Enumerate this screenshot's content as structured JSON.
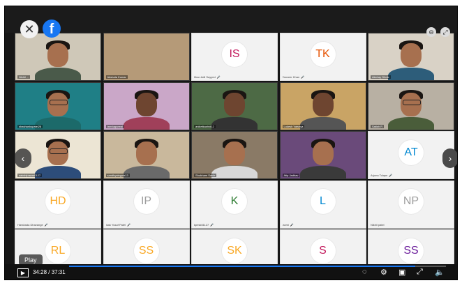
{
  "player": {
    "close_glyph": "✕",
    "facebook_glyph": "f",
    "play_tooltip": "Play",
    "time": "34:28 / 37:31",
    "progress_fraction": 0.919,
    "accent": "#1877f2"
  },
  "tiles": [
    {
      "kind": "video",
      "name": "Nikhil ...",
      "theme": "wall",
      "skin": "light",
      "shirt": "#4a5a4a"
    },
    {
      "kind": "video",
      "name": "Akshata Kumar",
      "theme": "tan",
      "skin": "none",
      "shirt": "#7a6b55"
    },
    {
      "kind": "avatar",
      "initials": "IS",
      "name": "Ilhan Adil Sayyed",
      "color": "#c2185b",
      "mic": true
    },
    {
      "kind": "avatar",
      "initials": "TK",
      "name": "Tanveer Khan",
      "color": "#e65100",
      "mic": true
    },
    {
      "kind": "video",
      "name": "Akshay Dhole",
      "theme": "room",
      "skin": "light",
      "shirt": "#2d5d7a"
    },
    {
      "kind": "video",
      "name": "shashankspatel28",
      "theme": "teal",
      "skin": "light",
      "shirt": "#1c6a6a",
      "glasses": true
    },
    {
      "kind": "video",
      "name": "tanviagarwal",
      "theme": "pink",
      "skin": "dark",
      "shirt": "#a0405a"
    },
    {
      "kind": "video",
      "name": "aniketkashid12",
      "theme": "green",
      "skin": "dark",
      "shirt": "#333333"
    },
    {
      "kind": "video",
      "name": "Lokesh Vaishya",
      "theme": "orange",
      "skin": "dark",
      "shirt": "#555555"
    },
    {
      "kind": "video",
      "name": "Satish R",
      "theme": "gray",
      "skin": "light",
      "shirt": "#4a5d3a",
      "glasses": true
    },
    {
      "kind": "video",
      "name": "sakshipawar0127",
      "theme": "cream",
      "skin": "light",
      "shirt": "#2d4d7a",
      "glasses": true
    },
    {
      "kind": "video",
      "name": "sandhyaingole13",
      "theme": "beige",
      "skin": "light",
      "shirt": "#6a6a6a"
    },
    {
      "kind": "video",
      "name": "Shubham Sable",
      "theme": "shelf",
      "skin": "light",
      "shirt": "#d8d8d8"
    },
    {
      "kind": "video",
      "name": "Atip Jadhav",
      "theme": "purple",
      "skin": "light",
      "shirt": "#3a3a3a"
    },
    {
      "kind": "avatar",
      "initials": "AT",
      "name": "Arjuna Tolape",
      "color": "#0288d1",
      "mic": true
    },
    {
      "kind": "avatar",
      "initials": "HD",
      "name": "Harshada Dhavange",
      "color": "#f9a825",
      "mic": true
    },
    {
      "kind": "avatar",
      "initials": "IP",
      "name": "Ikak Yusuf Patel",
      "color": "#9e9e9e",
      "mic": true
    },
    {
      "kind": "avatar",
      "initials": "K",
      "name": "kprisk51127",
      "color": "#2e7d32",
      "mic": true
    },
    {
      "kind": "avatar",
      "initials": "L",
      "name": "laxmi",
      "color": "#0288d1",
      "mic": true
    },
    {
      "kind": "avatar",
      "initials": "NP",
      "name": "Nikhil patel",
      "color": "#9e9e9e",
      "mic": false
    },
    {
      "kind": "avatar",
      "initials": "RL",
      "name": "",
      "color": "#f9a825",
      "mic": false
    },
    {
      "kind": "avatar",
      "initials": "SS",
      "name": "",
      "color": "#f9a825",
      "mic": false
    },
    {
      "kind": "avatar",
      "initials": "SK",
      "name": "",
      "color": "#f9a825",
      "mic": false
    },
    {
      "kind": "avatar",
      "initials": "S",
      "name": "",
      "color": "#c2185b",
      "mic": false
    },
    {
      "kind": "avatar",
      "initials": "SS",
      "name": "",
      "color": "#6a1b9a",
      "mic": false
    }
  ],
  "controls": {
    "play_icon": "play-icon",
    "play_glyph": "▶",
    "icons": [
      {
        "name": "captions-icon",
        "glyph": "◌"
      },
      {
        "name": "settings-icon",
        "glyph": "⚙"
      },
      {
        "name": "pip-icon",
        "glyph": "▣"
      },
      {
        "name": "fullscreen-icon",
        "glyph": "⤢"
      },
      {
        "name": "volume-icon",
        "glyph": "🔈"
      }
    ]
  },
  "dock_colors": [
    "#d93025",
    "#3c3c3c",
    "#3c3c3c",
    "#3c3c3c",
    "#3c3c3c",
    "#3c3c3c",
    "#d93025"
  ]
}
